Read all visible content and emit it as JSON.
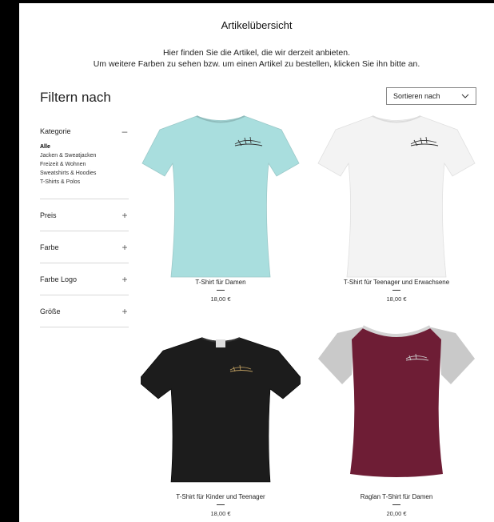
{
  "page": {
    "title": "Artikelübersicht",
    "intro_line1": "Hier finden Sie die Artikel, die wir derzeit anbieten.",
    "intro_line2": "Um weitere Farben zu sehen bzw. um einen Artikel zu bestellen, klicken Sie ihn bitte an."
  },
  "filters": {
    "heading": "Filtern nach",
    "groups": [
      {
        "label": "Kategorie",
        "toggle": "–",
        "expanded": true,
        "items": [
          "Alle",
          "Jacken & Sweatjacken",
          "Freizeit & Wohnen",
          "Sweatshirts & Hoodies",
          "T-Shirts & Polos"
        ],
        "active": "Alle"
      },
      {
        "label": "Preis",
        "toggle": "+"
      },
      {
        "label": "Farbe",
        "toggle": "+"
      },
      {
        "label": "Farbe Logo",
        "toggle": "+"
      },
      {
        "label": "Größe",
        "toggle": "+"
      }
    ]
  },
  "sort": {
    "label": "Sortieren nach",
    "icon": "chevron-down-icon"
  },
  "products": [
    {
      "name": "T-Shirt für Damen",
      "price": "18,00 €",
      "color": "#a9dede"
    },
    {
      "name": "T-Shirt für Teenager und Erwachsene",
      "price": "18,00 €",
      "color": "#f3f3f3"
    },
    {
      "name": "T-Shirt für Kinder und Teenager",
      "price": "18,00 €",
      "color": "#1c1c1c"
    },
    {
      "name": "Raglan T-Shirt für Damen",
      "price": "20,00 €",
      "color": "#6e1d35",
      "sleeve_color": "#c9c9c9"
    }
  ]
}
